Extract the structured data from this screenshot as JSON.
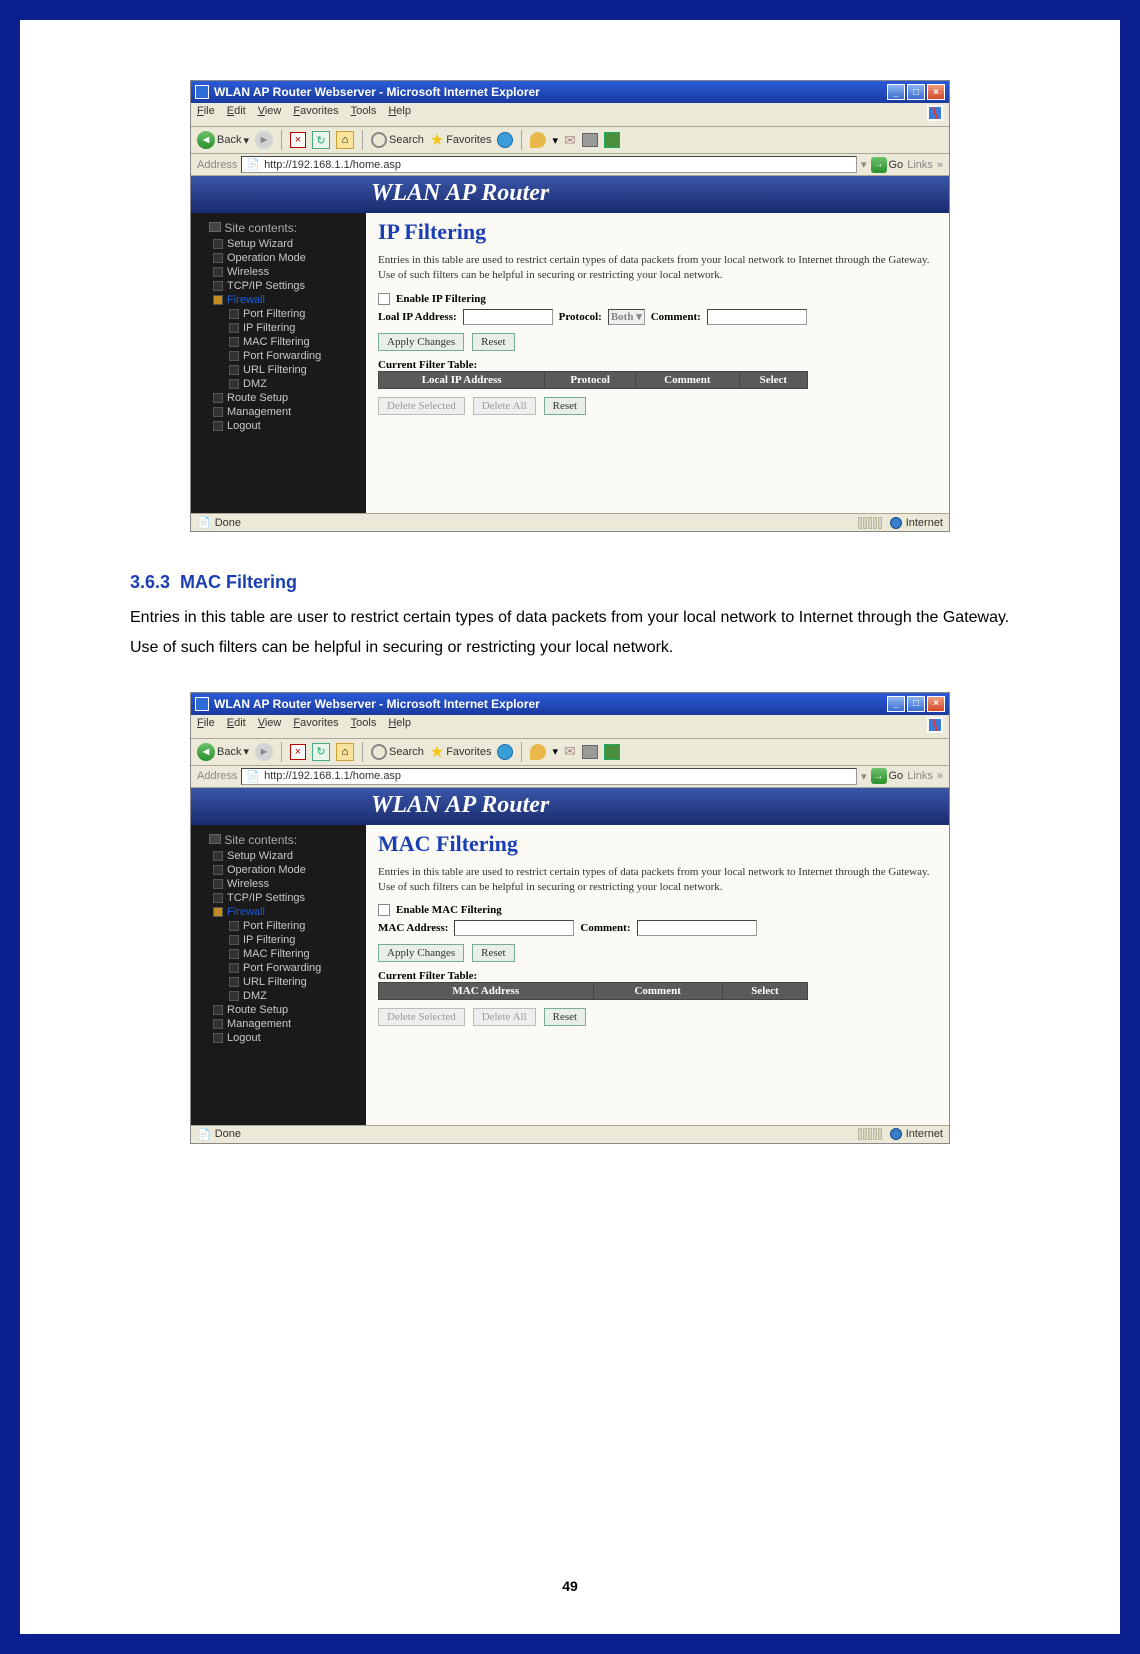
{
  "ie": {
    "windowTitle": "WLAN AP Router Webserver - Microsoft Internet Explorer",
    "menu": [
      "File",
      "Edit",
      "View",
      "Favorites",
      "Tools",
      "Help"
    ],
    "toolbar": {
      "back": "Back",
      "search": "Search",
      "favorites": "Favorites"
    },
    "address": {
      "label": "Address",
      "url": "http://192.168.1.1/home.asp",
      "go": "Go",
      "links": "Links"
    },
    "status": {
      "done": "Done",
      "zone": "Internet"
    }
  },
  "router": {
    "banner": "WLAN AP Router",
    "sidebar": {
      "head": "Site contents:",
      "items": [
        "Setup Wizard",
        "Operation Mode",
        "Wireless",
        "TCP/IP Settings"
      ],
      "firewall": "Firewall",
      "sub": [
        "Port Filtering",
        "IP Filtering",
        "MAC Filtering",
        "Port Forwarding",
        "URL Filtering",
        "DMZ"
      ],
      "after": [
        "Route Setup",
        "Management",
        "Logout"
      ]
    }
  },
  "shot1": {
    "title": "IP Filtering",
    "desc": "Entries in this table are used to restrict certain types of data packets from your local network to Internet through the Gateway. Use of such filters can be helpful in securing or restricting your local network.",
    "enable": "Enable IP Filtering",
    "field1": "Loal IP Address:",
    "field2": "Protocol:",
    "field2val": "Both",
    "field3": "Comment:",
    "apply": "Apply Changes",
    "reset": "Reset",
    "tableTitle": "Current Filter Table:",
    "th": [
      "Local IP Address",
      "Protocol",
      "Comment",
      "Select"
    ],
    "delSel": "Delete Selected",
    "delAll": "Delete All",
    "reset2": "Reset"
  },
  "shot2": {
    "title": "MAC Filtering",
    "desc": "Entries in this table are used to restrict certain types of data packets from your local network to Internet through the Gateway. Use of such filters can be helpful in securing or restricting your local network.",
    "enable": "Enable MAC Filtering",
    "field1": "MAC Address:",
    "field2": "Comment:",
    "apply": "Apply Changes",
    "reset": "Reset",
    "tableTitle": "Current Filter Table:",
    "th": [
      "MAC Address",
      "Comment",
      "Select"
    ],
    "delSel": "Delete Selected",
    "delAll": "Delete All",
    "reset2": "Reset"
  },
  "doc": {
    "headingNum": "3.6.3",
    "headingText": "MAC Filtering",
    "para": "Entries in this table are user to restrict certain types of data packets from your local network to Internet through the Gateway. Use of such filters can be helpful in securing or restricting your local network."
  },
  "pageNumber": "49"
}
